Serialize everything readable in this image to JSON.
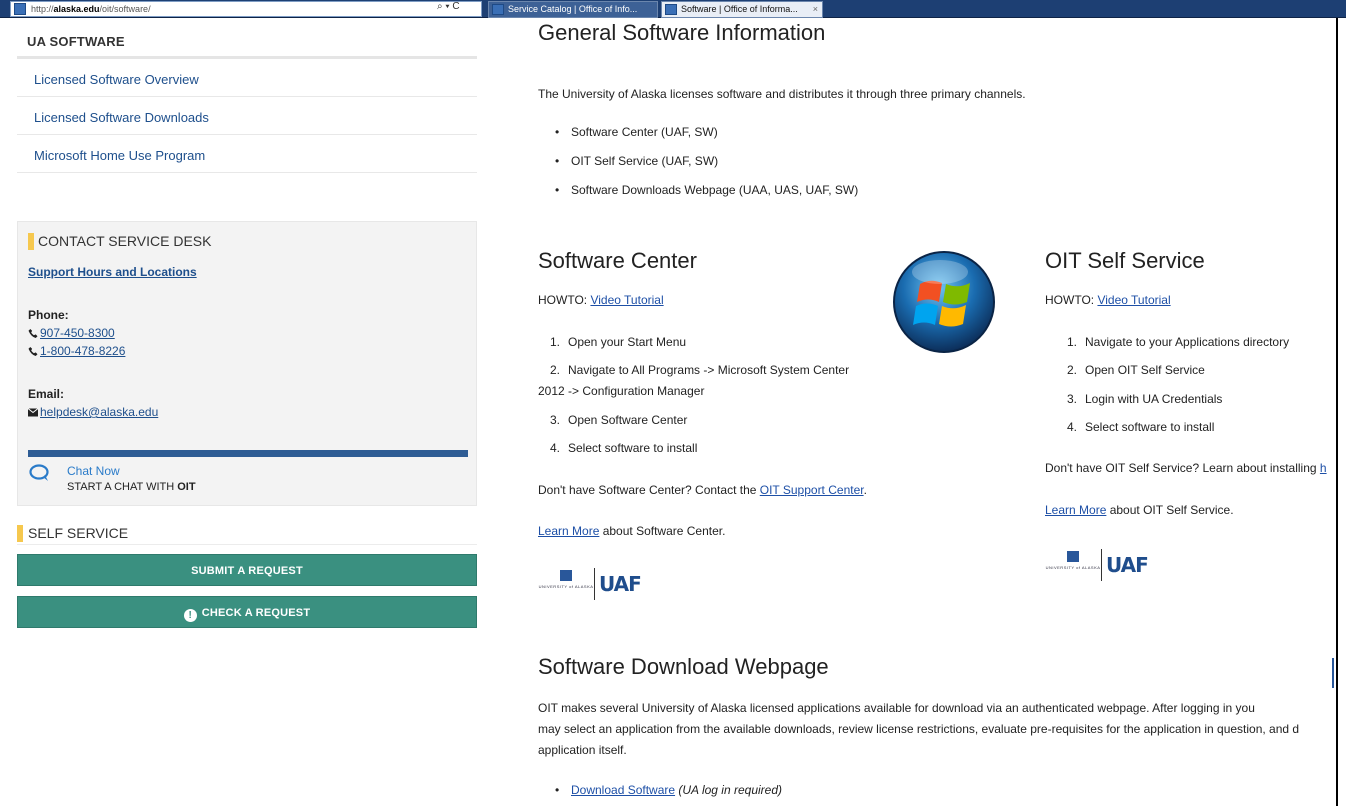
{
  "browser": {
    "address": {
      "scheme": "http://",
      "host": "alaska.edu",
      "path": "/oit/software/"
    },
    "address_controls": "⌕ ▾ C",
    "tabs": [
      {
        "label": "Service Catalog | Office of Info..."
      },
      {
        "label": "Software | Office of Informa...",
        "close": "×"
      }
    ]
  },
  "sidebar": {
    "heading": "UA SOFTWARE",
    "links": [
      "Licensed Software Overview",
      "Licensed Software Downloads",
      "Microsoft Home Use Program"
    ],
    "contact": {
      "title": "CONTACT SERVICE DESK",
      "support_link": "Support Hours and Locations",
      "phone_label": "Phone:",
      "phones": [
        "907-450-8300",
        "1-800-478-8226"
      ],
      "email_label": "Email:",
      "email": "helpdesk@alaska.edu",
      "chat_now": "Chat Now",
      "chat_start_prefix": "START A CHAT WITH ",
      "chat_start_bold": "OIT"
    },
    "self_service": {
      "title": "SELF SERVICE",
      "submit": "SUBMIT A REQUEST",
      "check": "CHECK A REQUEST"
    }
  },
  "main": {
    "general": {
      "title": "General Software Information",
      "intro": "The University of Alaska licenses software and distributes it through three primary channels.",
      "channels": [
        "Software Center (UAF, SW)",
        "OIT Self Service (UAF, SW)",
        "Software Downloads Webpage (UAA, UAS, UAF, SW)"
      ]
    },
    "software_center": {
      "title": "Software Center",
      "howto_label": "HOWTO: ",
      "howto_link": "Video Tutorial",
      "steps": [
        {
          "n": "1.",
          "text": "Open your Start Menu"
        },
        {
          "n": "2.",
          "text": "Navigate to All Programs -> Microsoft System Center"
        },
        {
          "n": "",
          "text": "2012 -> Configuration Manager"
        },
        {
          "n": "3.",
          "text": "Open Software Center"
        },
        {
          "n": "4.",
          "text": "Select software to install"
        }
      ],
      "dont_have_prefix": "Don't have Software Center? Contact the ",
      "dont_have_link": "OIT Support Center",
      "dont_have_suffix": ".",
      "learn_link": "Learn More",
      "learn_suffix": " about Software Center."
    },
    "oit_self_service": {
      "title": "OIT Self Service",
      "howto_label": "HOWTO: ",
      "howto_link": "Video Tutorial",
      "steps": [
        {
          "n": "1.",
          "text": "Navigate to your Applications directory"
        },
        {
          "n": "2.",
          "text": "Open OIT Self Service"
        },
        {
          "n": "3.",
          "text": "Login with UA Credentials"
        },
        {
          "n": "4.",
          "text": "Select software to install"
        }
      ],
      "dont_have_prefix": "Don't have OIT Self Service? Learn about installing ",
      "dont_have_link": "h",
      "learn_link": "Learn More",
      "learn_suffix": " about OIT Self Service."
    },
    "download": {
      "title": "Software Download Webpage",
      "lines": [
        "OIT makes several University of Alaska licensed applications available for download via an authenticated webpage. After logging in you",
        "may select an application from the available downloads, review license restrictions, evaluate pre-requisites for the application in question, and d",
        "application itself."
      ],
      "link": "Download Software",
      "note": " (UA log in required)"
    },
    "logo": {
      "ua_text": "UNIVERSITY of ALASKA",
      "uaf_text": "UAF"
    }
  },
  "colors": {
    "link": "#1d4fa6",
    "teal": "#3a9080",
    "accent_yellow": "#f6c84e",
    "navy": "#2e5c94"
  }
}
